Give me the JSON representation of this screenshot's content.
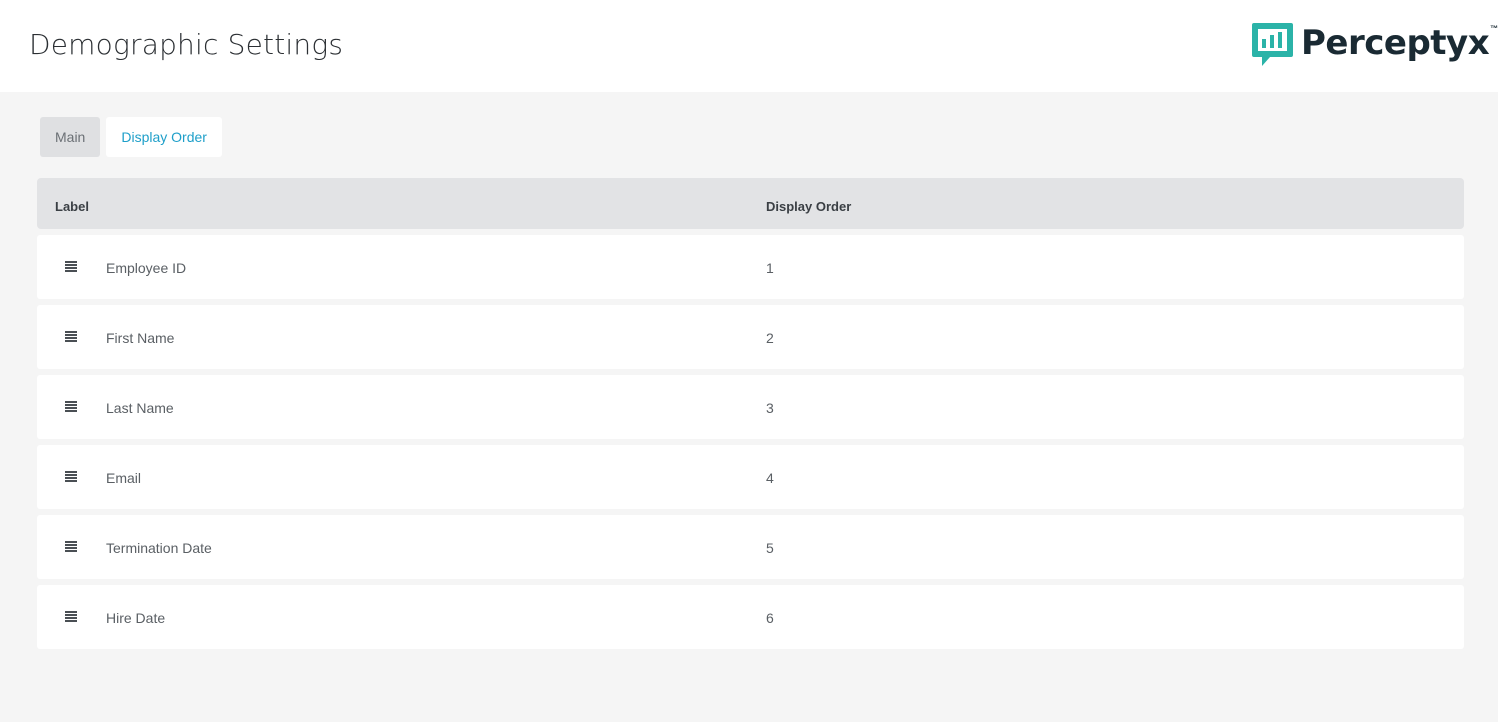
{
  "header": {
    "title": "Demographic Settings",
    "logo_text": "Perceptyx",
    "logo_tm": "™",
    "brand_color": "#2bb3a8"
  },
  "tabs": [
    {
      "label": "Main",
      "active": false
    },
    {
      "label": "Display Order",
      "active": true
    }
  ],
  "table": {
    "columns": [
      "Label",
      "Display Order"
    ],
    "rows": [
      {
        "label": "Employee ID",
        "order": "1"
      },
      {
        "label": "First Name",
        "order": "2"
      },
      {
        "label": "Last Name",
        "order": "3"
      },
      {
        "label": "Email",
        "order": "4"
      },
      {
        "label": "Termination Date",
        "order": "5"
      },
      {
        "label": "Hire Date",
        "order": "6"
      }
    ],
    "row_icon": "drag-handle-icon"
  }
}
